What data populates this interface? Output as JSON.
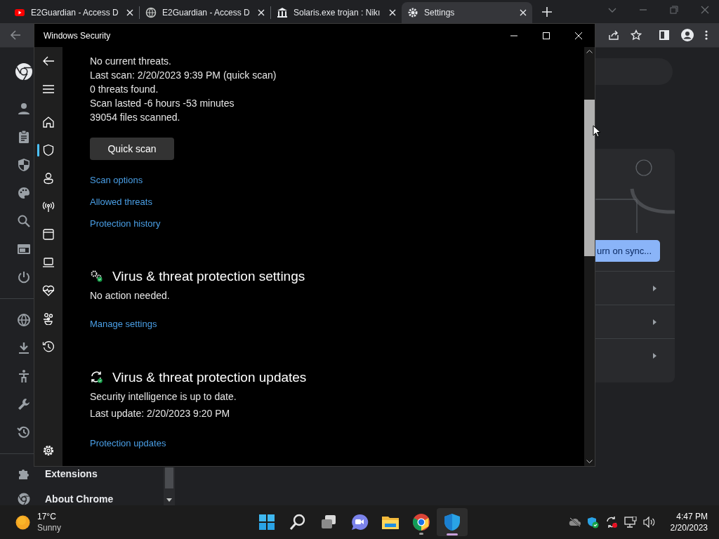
{
  "browser": {
    "tabs": [
      {
        "kind": "youtube",
        "title": "E2Guardian - Access D",
        "selected": false
      },
      {
        "kind": "globe",
        "title": "E2Guardian - Access D",
        "selected": false
      },
      {
        "kind": "museum",
        "title": "Solaris.exe trojan : Nikı",
        "selected": false
      },
      {
        "kind": "gear",
        "title": "Settings",
        "selected": true
      }
    ],
    "sidebar": {
      "groups": [
        {
          "items": [
            {
              "kind": "person"
            },
            {
              "kind": "clipboard"
            },
            {
              "kind": "shield"
            },
            {
              "kind": "palette"
            },
            {
              "kind": "search"
            },
            {
              "kind": "browser"
            },
            {
              "kind": "power"
            }
          ]
        },
        {
          "items": [
            {
              "kind": "globe"
            },
            {
              "kind": "download"
            },
            {
              "kind": "accessibility"
            },
            {
              "kind": "wrench"
            },
            {
              "kind": "history"
            }
          ]
        },
        {
          "items": [
            {
              "kind": "puzzle",
              "label": "Extensions"
            },
            {
              "kind": "chrome",
              "label": "About Chrome"
            }
          ]
        }
      ]
    },
    "sync_button": "urn on sync..."
  },
  "security_window": {
    "title": "Windows Security",
    "nav": [
      {
        "kind": "home",
        "selected": false
      },
      {
        "kind": "shield",
        "selected": true
      },
      {
        "kind": "person",
        "selected": false
      },
      {
        "kind": "antenna",
        "selected": false
      },
      {
        "kind": "window",
        "selected": false
      },
      {
        "kind": "laptop",
        "selected": false
      },
      {
        "kind": "heart",
        "selected": false
      },
      {
        "kind": "family",
        "selected": false
      },
      {
        "kind": "history",
        "selected": false
      }
    ],
    "sections": [
      {
        "lines": [
          "No current threats.",
          "Last scan: 2/20/2023 9:39 PM (quick scan)",
          "0 threats found.",
          "Scan lasted -6 hours -53 minutes",
          "39054 files scanned."
        ],
        "button": "Quick scan",
        "links": [
          "Scan options",
          "Allowed threats",
          "Protection history"
        ]
      },
      {
        "kind": "gears",
        "heading": "Virus & threat protection settings",
        "lines": [
          "No action needed."
        ],
        "links": [
          "Manage settings"
        ]
      },
      {
        "kind": "refresh",
        "heading": "Virus & threat protection updates",
        "lines": [
          "Security intelligence is up to date.",
          "Last update: 2/20/2023 9:20 PM"
        ],
        "links": [
          "Protection updates"
        ]
      }
    ]
  },
  "taskbar": {
    "weather": {
      "temperature": "17°C",
      "condition": "Sunny"
    },
    "apps": [
      {
        "kind": "start",
        "selected": false
      },
      {
        "kind": "search",
        "selected": false
      },
      {
        "kind": "taskview",
        "selected": false
      },
      {
        "kind": "chat",
        "selected": false
      },
      {
        "kind": "folder",
        "selected": false
      },
      {
        "kind": "chrome",
        "selected": false
      },
      {
        "kind": "security",
        "selected": true
      }
    ],
    "time": "4:47 PM",
    "date": "2/20/2023"
  }
}
